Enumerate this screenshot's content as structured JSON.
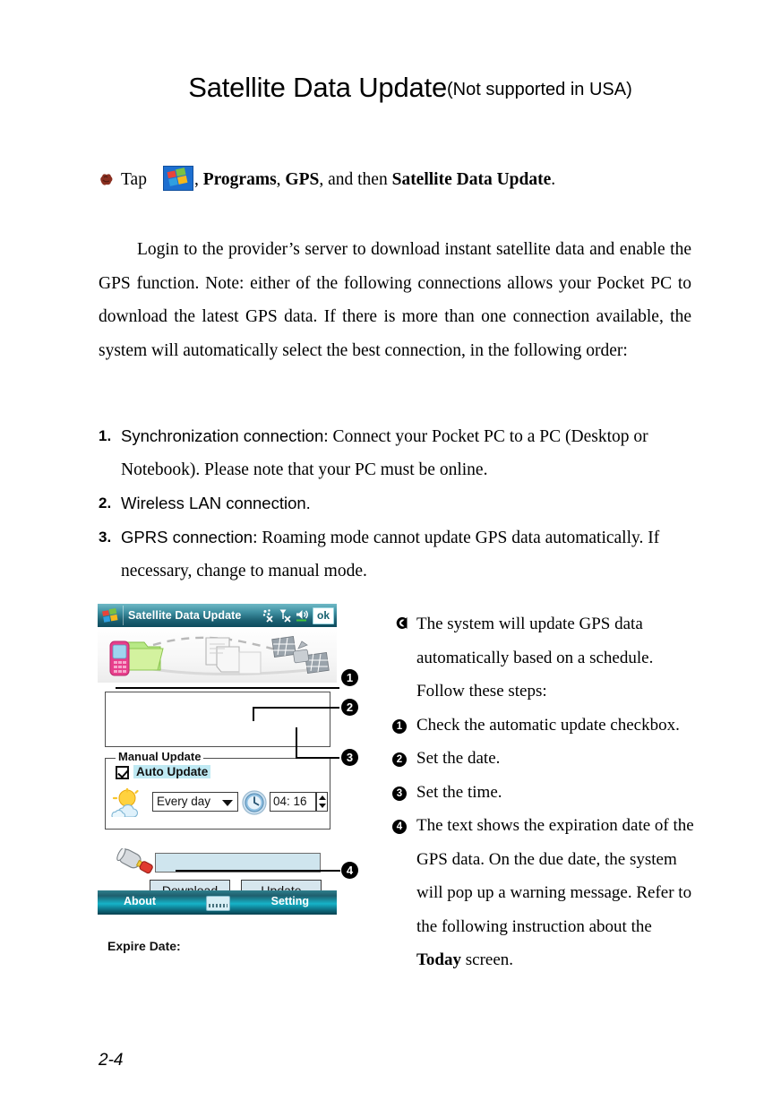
{
  "page": {
    "number": "2-4"
  },
  "title": {
    "main": "Satellite Data Update",
    "suffix": "(Not supported in USA)"
  },
  "tap_instruction": {
    "prefix": "Tap",
    "start_icon": "windows-start-flag-icon",
    "bullet_icon": "decorative-bullet-icon",
    "after_icon": ", ",
    "item1": "Programs",
    "sep1": ", ",
    "item2": "GPS",
    "sep2": ", and then ",
    "item3": "Satellite Data Update",
    "end": "."
  },
  "intro_paragraph": "Login to the provider’s server to download instant satellite data and enable the GPS function. Note: either of the following connections allows your Pocket PC to download the latest GPS data. If there is more than one connection available, the system will automatically select the best connection, in the following order:",
  "ordered_list": [
    {
      "num": "1.",
      "lead": "Synchronization connection",
      "rest": ": Connect your Pocket PC to a PC (Desktop or Notebook). Please note that your PC must be online."
    },
    {
      "num": "2.",
      "lead": "Wireless LAN connection.",
      "rest": ""
    },
    {
      "num": "3.",
      "lead": "GPRS connection",
      "rest": ": Roaming mode cannot update GPS data automatically. If necessary, change to manual mode."
    }
  ],
  "pda": {
    "titlebar": {
      "title": "Satellite Data Update",
      "ok_label": "ok",
      "icons": [
        "connectivity-off-icon",
        "signal-off-icon",
        "volume-icon"
      ]
    },
    "banner_icons": [
      "mobile-phone-icon",
      "folder-icon",
      "document-icon",
      "document-icon-2",
      "satellite-icon"
    ],
    "auto_update": {
      "checkbox_checked": true,
      "label": "Auto Update",
      "weather_icon": "sun-cloud-icon",
      "frequency_value": "Every day",
      "clock_icon": "clock-icon",
      "time_value": "04: 16"
    },
    "manual_update": {
      "legend": "Manual Update",
      "tool_icon": "hammer-icon",
      "status_value": "",
      "download_label": "Download",
      "update_label": "Update"
    },
    "expire": {
      "label": "Expire Date:",
      "value": ""
    },
    "toolbar": {
      "about_label": "About",
      "keyboard_icon": "keyboard-icon",
      "setting_label": "Setting"
    }
  },
  "callouts": [
    {
      "num": "1"
    },
    {
      "num": "2"
    },
    {
      "num": "3"
    },
    {
      "num": "4"
    }
  ],
  "notes": [
    {
      "marker": "☚",
      "marker_type": "arrow",
      "text": "The system will update GPS data automatically based on a schedule. Follow these steps:"
    },
    {
      "marker": "1",
      "marker_type": "dot",
      "text": "Check the automatic update checkbox."
    },
    {
      "marker": "2",
      "marker_type": "dot",
      "text": "Set the date."
    },
    {
      "marker": "3",
      "marker_type": "dot",
      "text": "Set the time."
    },
    {
      "marker": "4",
      "marker_type": "dot",
      "text_part1": "The text shows the expiration date of the GPS data. On the due date, the system will pop up a warning message. Refer to the following instruction about the ",
      "bold": "Today",
      "text_part2": " screen."
    }
  ],
  "colors": {
    "titlebar_teal": "#1d6274",
    "toolbar_teal": "#16b3c8",
    "highlight_cyan": "#bfe9f3",
    "button_face": "#d6e6ee"
  }
}
